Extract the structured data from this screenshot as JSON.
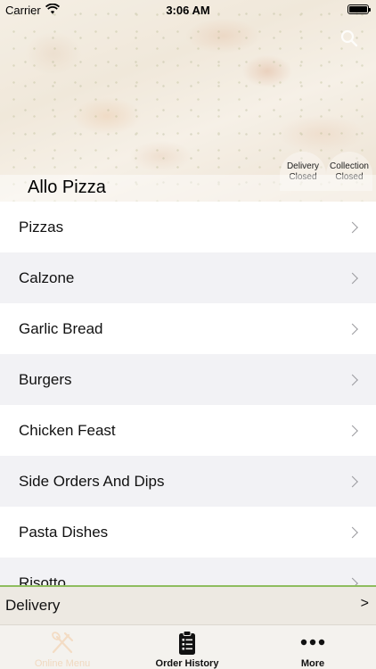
{
  "status_bar": {
    "carrier": "Carrier",
    "time": "3:06 AM"
  },
  "header": {
    "restaurant_name": "Allo Pizza",
    "delivery_status_line1": "Delivery",
    "delivery_status_line2": "Closed",
    "collection_status_line1": "Collection",
    "collection_status_line2": "Closed"
  },
  "menu": {
    "items": [
      {
        "label": "Pizzas"
      },
      {
        "label": "Calzone"
      },
      {
        "label": "Garlic Bread"
      },
      {
        "label": "Burgers"
      },
      {
        "label": "Chicken Feast"
      },
      {
        "label": "Side Orders And Dips"
      },
      {
        "label": "Pasta Dishes"
      },
      {
        "label": "Risotto"
      }
    ]
  },
  "order_bar": {
    "mode": "Delivery",
    "arrow": ">"
  },
  "tabs": [
    {
      "label": "Online Menu",
      "icon": "fork-knife-icon",
      "active": true
    },
    {
      "label": "Order History",
      "icon": "clipboard-icon",
      "active": false
    },
    {
      "label": "More",
      "icon": "more-dots-icon",
      "active": false
    }
  ],
  "colors": {
    "accent_green": "#8ebd5f",
    "faded_tab": "#f0d8bf"
  }
}
